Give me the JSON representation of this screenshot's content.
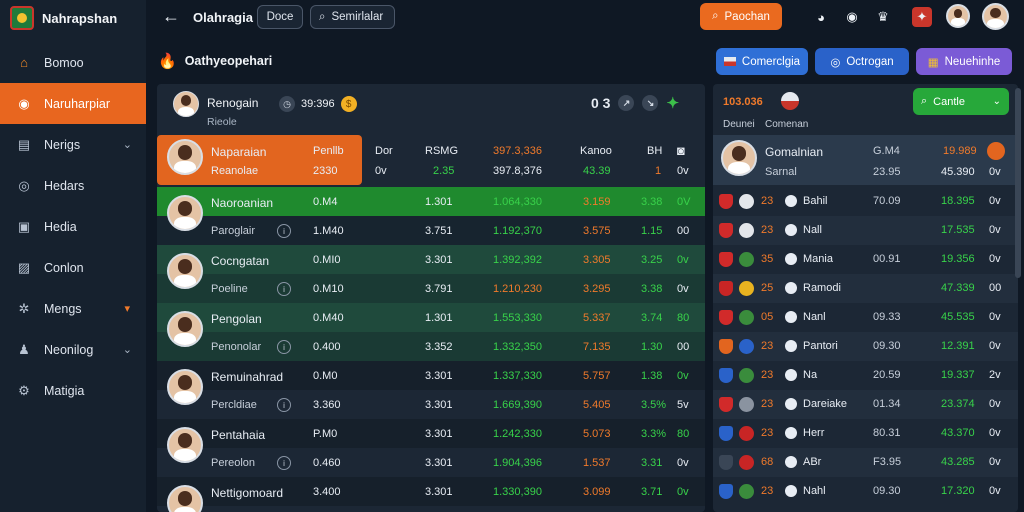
{
  "app": {
    "brand": "Nahrapshan"
  },
  "sidebar": {
    "items": [
      {
        "label": "Bomoo",
        "icon": "home-icon",
        "active": false
      },
      {
        "label": "Naruharpiar",
        "icon": "star-icon",
        "active": true
      },
      {
        "label": "Nerigs",
        "icon": "briefcase-icon",
        "active": false,
        "chevron": true
      },
      {
        "label": "Hedars",
        "icon": "shield-icon",
        "active": false
      },
      {
        "label": "Hedia",
        "icon": "image-icon",
        "active": false
      },
      {
        "label": "Conlon",
        "icon": "chart-icon",
        "active": false
      },
      {
        "label": "Mengs",
        "icon": "settings-icon",
        "active": false,
        "badge": "▾"
      },
      {
        "label": "Neonilog",
        "icon": "people-icon",
        "active": false,
        "chevron": true
      },
      {
        "label": "Matigia",
        "icon": "gear-icon",
        "active": false
      }
    ]
  },
  "topbar": {
    "title": "Olahragia",
    "button1": "Doce",
    "search_label": "Semirlalar",
    "primary_button": "Paochan"
  },
  "section": {
    "title": "Oathyeopehari",
    "chips": [
      {
        "label": "Comerclgia",
        "color": "#2f6fd6"
      },
      {
        "label": "Octrogan",
        "color": "#2a62c9"
      },
      {
        "label": "Neuehinhe",
        "color": "#7b5bd6"
      }
    ]
  },
  "main": {
    "header": {
      "name": "Renogain",
      "score": "39:396",
      "sub": "Rieole",
      "right_score": "0 3"
    },
    "highlight": {
      "name": "Naparaian",
      "sub": "Reanolae",
      "col_a": "Penllb",
      "col_a2": "2330",
      "headers": [
        "Dor",
        "RSMG",
        "397.3,336",
        "Kanoo",
        "BH"
      ],
      "values": [
        "0v",
        "2.35",
        "397.8,376",
        "43.39",
        "1",
        "0v"
      ]
    },
    "rows": [
      {
        "name": "Naoroanian",
        "sub": "Paroglair",
        "stat1": "0.M4",
        "stat2": "1.M40",
        "c1": "1.301",
        "c2": "3.751",
        "c3": "1.064,330",
        "c4": "1.192,370",
        "c5": "3.159",
        "c6": "3.575",
        "c7": "3.38",
        "c8": "1.15",
        "c9": "0V",
        "c10": "00",
        "bg": "green"
      },
      {
        "name": "Cocngatan",
        "sub": "Poeline",
        "stat1": "0.MI0",
        "stat2": "0.M10",
        "c1": "3.301",
        "c2": "3.791",
        "c3": "1.392,392",
        "c4": "1.210,230",
        "c5": "3.305",
        "c6": "3.295",
        "c7": "3.25",
        "c8": "3.38",
        "c9": "0v",
        "c10": "0v",
        "bg": "teal"
      },
      {
        "name": "Pengolan",
        "sub": "Penonolar",
        "stat1": "0.M40",
        "stat2": "0.400",
        "c1": "1.301",
        "c2": "3.352",
        "c3": "1.553,330",
        "c4": "1.332,350",
        "c5": "5.337",
        "c6": "7.135",
        "c7": "3.74",
        "c8": "1.30",
        "c9": "80",
        "c10": "00",
        "bg": "teal"
      },
      {
        "name": "Remuinahrad",
        "sub": "Percldiae",
        "stat1": "0.M0",
        "stat2": "3.360",
        "c1": "3.301",
        "c2": "3.301",
        "c3": "1.337,330",
        "c4": "1.669,390",
        "c5": "5.757",
        "c6": "5.405",
        "c7": "1.38",
        "c8": "3.5%",
        "c9": "0v",
        "c10": "5v",
        "bg": "dark"
      },
      {
        "name": "Pentahaia",
        "sub": "Pereolon",
        "stat1": "P.M0",
        "stat2": "0.460",
        "c1": "3.301",
        "c2": "3.301",
        "c3": "1.242,330",
        "c4": "1.904,396",
        "c5": "5.073",
        "c6": "1.537",
        "c7": "3.3%",
        "c8": "3.31",
        "c9": "80",
        "c10": "0v",
        "bg": "dark"
      },
      {
        "name": "Nettigomoard",
        "sub": "",
        "stat1": "3.400",
        "stat2": "",
        "c1": "3.301",
        "c2": "",
        "c3": "1.330,390",
        "c4": "",
        "c5": "3.099",
        "c6": "",
        "c7": "3.71",
        "c8": "",
        "c9": "0v",
        "c10": "",
        "bg": "dark"
      }
    ]
  },
  "right": {
    "title": "103.036",
    "sub_left": "Deunei",
    "sub_right": "Comenan",
    "button": "Cantle",
    "feature": {
      "name": "Gomalnian",
      "sub": "Sarnal",
      "v1": "G.M4",
      "v1b": "23.95",
      "v2": "19.989",
      "v2b": "45.390",
      "end": "0v"
    },
    "rows": [
      {
        "n": "23",
        "name": "Bahil",
        "v1": "70.09",
        "v2": "18.395",
        "end": "0v",
        "shield": "#d12a2a",
        "crest": "#e3e6ea"
      },
      {
        "n": "23",
        "name": "Nall",
        "v1": "",
        "v2": "17.535",
        "end": "0v",
        "shield": "#d12a2a",
        "crest": "#e3e6ea"
      },
      {
        "n": "35",
        "name": "Mania",
        "v1": "00.91",
        "v2": "19.356",
        "end": "0v",
        "shield": "#d12a2a",
        "crest": "#3a8c3c"
      },
      {
        "n": "25",
        "name": "Ramodi",
        "v1": "",
        "v2": "47.339",
        "end": "00",
        "shield": "#c82525",
        "crest": "#e9b320"
      },
      {
        "n": "05",
        "name": "Nanl",
        "v1": "09.33",
        "v2": "45.535",
        "end": "0v",
        "shield": "#d12a2a",
        "crest": "#3a8c3c"
      },
      {
        "n": "23",
        "name": "Pantori",
        "v1": "09.30",
        "v2": "12.391",
        "end": "0v",
        "shield": "#e2651f",
        "crest": "#2a62c9"
      },
      {
        "n": "23",
        "name": "Na",
        "v1": "20.59",
        "v2": "19.337",
        "end": "2v",
        "shield": "#2a62c9",
        "crest": "#3a8c3c"
      },
      {
        "n": "23",
        "name": "Dareiake",
        "v1": "01.34",
        "v2": "23.374",
        "end": "0v",
        "shield": "#d12a2a",
        "crest": "#8a93a0"
      },
      {
        "n": "23",
        "name": "Herr",
        "v1": "80.31",
        "v2": "43.370",
        "end": "0v",
        "shield": "#2a62c9",
        "crest": "#c82525"
      },
      {
        "n": "68",
        "name": "ABr",
        "v1": "F3.95",
        "v2": "43.285",
        "end": "0v",
        "shield": "#3a4656",
        "crest": "#c82525"
      },
      {
        "n": "23",
        "name": "Nahl",
        "v1": "09.30",
        "v2": "17.320",
        "end": "0v",
        "shield": "#2a62c9",
        "crest": "#3a8c3c"
      }
    ]
  }
}
